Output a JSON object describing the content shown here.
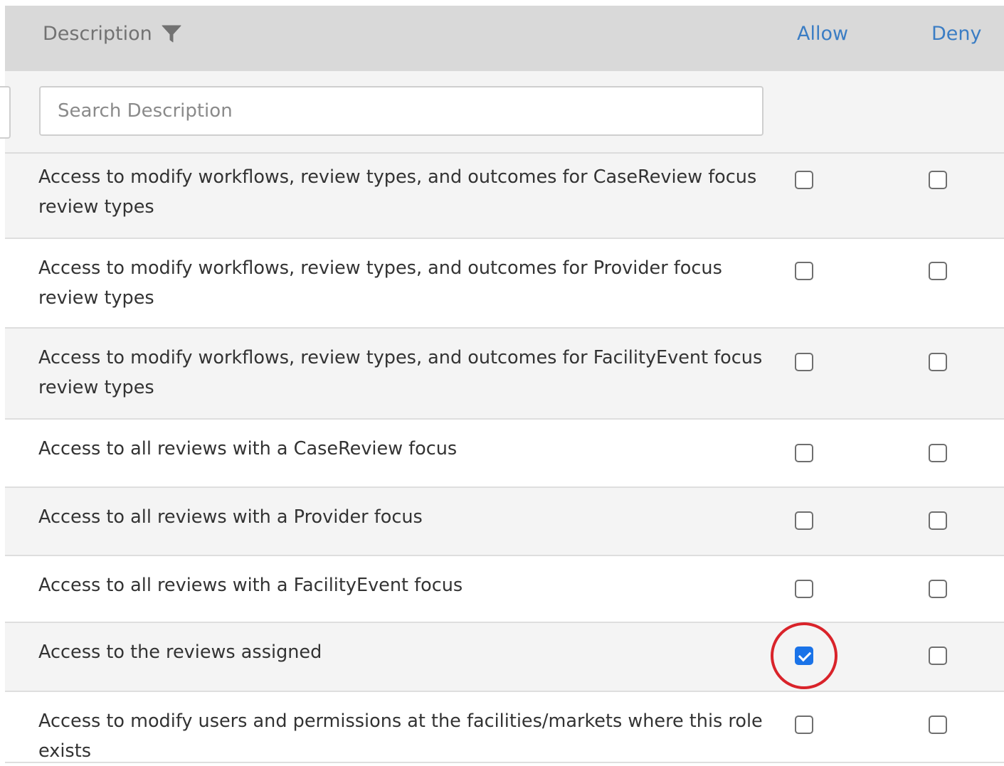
{
  "header": {
    "description_label": "Description",
    "filter_icon": "funnel-icon",
    "allow_label": "Allow",
    "deny_label": "Deny"
  },
  "filter": {
    "search_placeholder": "Search Description",
    "search_value": ""
  },
  "rows": [
    {
      "description": "Access to modify workflows, review types, and outcomes for CaseReview focus review types",
      "allow": false,
      "deny": false
    },
    {
      "description": "Access to modify workflows, review types, and outcomes for Provider focus review types",
      "allow": false,
      "deny": false
    },
    {
      "description": "Access to modify workflows, review types, and outcomes for FacilityEvent focus review types",
      "allow": false,
      "deny": false
    },
    {
      "description": "Access to all reviews with a CaseReview focus",
      "allow": false,
      "deny": false
    },
    {
      "description": "Access to all reviews with a Provider focus",
      "allow": false,
      "deny": false
    },
    {
      "description": "Access to all reviews with a FacilityEvent focus",
      "allow": false,
      "deny": false
    },
    {
      "description": "Access to the reviews assigned",
      "allow": true,
      "deny": false
    },
    {
      "description": "Access to modify users and permissions at the facilities/markets where this role exists",
      "allow": false,
      "deny": false
    }
  ],
  "colors": {
    "header_bg": "#d9d9d9",
    "link_blue": "#3b7dc4",
    "checkbox_checked": "#1a73e8",
    "annotation_red": "#d9232a"
  }
}
